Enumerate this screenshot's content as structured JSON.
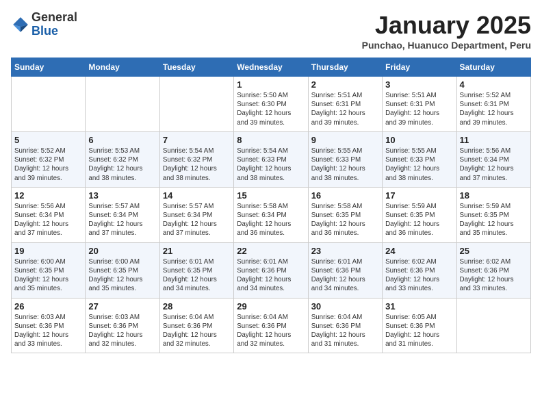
{
  "header": {
    "logo": {
      "general": "General",
      "blue": "Blue"
    },
    "title": "January 2025",
    "subtitle": "Punchao, Huanuco Department, Peru"
  },
  "weekdays": [
    "Sunday",
    "Monday",
    "Tuesday",
    "Wednesday",
    "Thursday",
    "Friday",
    "Saturday"
  ],
  "weeks": [
    [
      {
        "day": "",
        "info": ""
      },
      {
        "day": "",
        "info": ""
      },
      {
        "day": "",
        "info": ""
      },
      {
        "day": "1",
        "info": "Sunrise: 5:50 AM\nSunset: 6:30 PM\nDaylight: 12 hours\nand 39 minutes."
      },
      {
        "day": "2",
        "info": "Sunrise: 5:51 AM\nSunset: 6:31 PM\nDaylight: 12 hours\nand 39 minutes."
      },
      {
        "day": "3",
        "info": "Sunrise: 5:51 AM\nSunset: 6:31 PM\nDaylight: 12 hours\nand 39 minutes."
      },
      {
        "day": "4",
        "info": "Sunrise: 5:52 AM\nSunset: 6:31 PM\nDaylight: 12 hours\nand 39 minutes."
      }
    ],
    [
      {
        "day": "5",
        "info": "Sunrise: 5:52 AM\nSunset: 6:32 PM\nDaylight: 12 hours\nand 39 minutes."
      },
      {
        "day": "6",
        "info": "Sunrise: 5:53 AM\nSunset: 6:32 PM\nDaylight: 12 hours\nand 38 minutes."
      },
      {
        "day": "7",
        "info": "Sunrise: 5:54 AM\nSunset: 6:32 PM\nDaylight: 12 hours\nand 38 minutes."
      },
      {
        "day": "8",
        "info": "Sunrise: 5:54 AM\nSunset: 6:33 PM\nDaylight: 12 hours\nand 38 minutes."
      },
      {
        "day": "9",
        "info": "Sunrise: 5:55 AM\nSunset: 6:33 PM\nDaylight: 12 hours\nand 38 minutes."
      },
      {
        "day": "10",
        "info": "Sunrise: 5:55 AM\nSunset: 6:33 PM\nDaylight: 12 hours\nand 38 minutes."
      },
      {
        "day": "11",
        "info": "Sunrise: 5:56 AM\nSunset: 6:34 PM\nDaylight: 12 hours\nand 37 minutes."
      }
    ],
    [
      {
        "day": "12",
        "info": "Sunrise: 5:56 AM\nSunset: 6:34 PM\nDaylight: 12 hours\nand 37 minutes."
      },
      {
        "day": "13",
        "info": "Sunrise: 5:57 AM\nSunset: 6:34 PM\nDaylight: 12 hours\nand 37 minutes."
      },
      {
        "day": "14",
        "info": "Sunrise: 5:57 AM\nSunset: 6:34 PM\nDaylight: 12 hours\nand 37 minutes."
      },
      {
        "day": "15",
        "info": "Sunrise: 5:58 AM\nSunset: 6:34 PM\nDaylight: 12 hours\nand 36 minutes."
      },
      {
        "day": "16",
        "info": "Sunrise: 5:58 AM\nSunset: 6:35 PM\nDaylight: 12 hours\nand 36 minutes."
      },
      {
        "day": "17",
        "info": "Sunrise: 5:59 AM\nSunset: 6:35 PM\nDaylight: 12 hours\nand 36 minutes."
      },
      {
        "day": "18",
        "info": "Sunrise: 5:59 AM\nSunset: 6:35 PM\nDaylight: 12 hours\nand 35 minutes."
      }
    ],
    [
      {
        "day": "19",
        "info": "Sunrise: 6:00 AM\nSunset: 6:35 PM\nDaylight: 12 hours\nand 35 minutes."
      },
      {
        "day": "20",
        "info": "Sunrise: 6:00 AM\nSunset: 6:35 PM\nDaylight: 12 hours\nand 35 minutes."
      },
      {
        "day": "21",
        "info": "Sunrise: 6:01 AM\nSunset: 6:35 PM\nDaylight: 12 hours\nand 34 minutes."
      },
      {
        "day": "22",
        "info": "Sunrise: 6:01 AM\nSunset: 6:36 PM\nDaylight: 12 hours\nand 34 minutes."
      },
      {
        "day": "23",
        "info": "Sunrise: 6:01 AM\nSunset: 6:36 PM\nDaylight: 12 hours\nand 34 minutes."
      },
      {
        "day": "24",
        "info": "Sunrise: 6:02 AM\nSunset: 6:36 PM\nDaylight: 12 hours\nand 33 minutes."
      },
      {
        "day": "25",
        "info": "Sunrise: 6:02 AM\nSunset: 6:36 PM\nDaylight: 12 hours\nand 33 minutes."
      }
    ],
    [
      {
        "day": "26",
        "info": "Sunrise: 6:03 AM\nSunset: 6:36 PM\nDaylight: 12 hours\nand 33 minutes."
      },
      {
        "day": "27",
        "info": "Sunrise: 6:03 AM\nSunset: 6:36 PM\nDaylight: 12 hours\nand 32 minutes."
      },
      {
        "day": "28",
        "info": "Sunrise: 6:04 AM\nSunset: 6:36 PM\nDaylight: 12 hours\nand 32 minutes."
      },
      {
        "day": "29",
        "info": "Sunrise: 6:04 AM\nSunset: 6:36 PM\nDaylight: 12 hours\nand 32 minutes."
      },
      {
        "day": "30",
        "info": "Sunrise: 6:04 AM\nSunset: 6:36 PM\nDaylight: 12 hours\nand 31 minutes."
      },
      {
        "day": "31",
        "info": "Sunrise: 6:05 AM\nSunset: 6:36 PM\nDaylight: 12 hours\nand 31 minutes."
      },
      {
        "day": "",
        "info": ""
      }
    ]
  ]
}
